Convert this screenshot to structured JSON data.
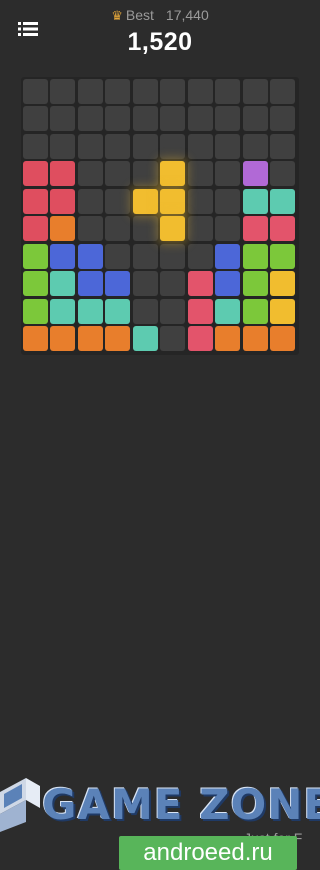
{
  "header": {
    "best_label": "Best",
    "best_score": "17,440",
    "score": "1,520",
    "menu_icon": "menu-icon",
    "crown_icon": "crown-icon"
  },
  "board": {
    "rows": 10,
    "cols": 10,
    "colors": {
      "E": "#404040",
      "R": "#df4e5f",
      "O": "#e87e2c",
      "G": "#7cc83a",
      "B": "#4c67d8",
      "T": "#5dcbb0",
      "P": "#e3546b",
      "V": "#b169d6",
      "Y": "#f1bd2f"
    },
    "grid": [
      "EEEEEEEEEE",
      "EEEEEEEEEE",
      "EEEEEEEEEE",
      "RREEEEEEVE",
      "RREEEEEETT",
      "ROEEEEEEPP",
      "GBBEEEEBGG",
      "GTBBEEPBGY",
      "GTTTEEPTGY",
      "OOOOTEPOOO"
    ]
  },
  "active_piece": {
    "color": "#f1bd2f",
    "cells": [
      [
        3,
        5
      ],
      [
        4,
        4
      ],
      [
        4,
        5
      ],
      [
        5,
        5
      ]
    ]
  },
  "watermark": {
    "brand": "GAME ZONE",
    "tagline": "Just for F",
    "site": "androeed.ru",
    "icon": "gamezone-logo-icon"
  }
}
